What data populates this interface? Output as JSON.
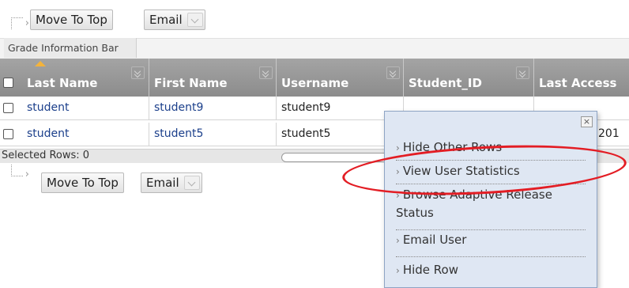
{
  "top_action_bar": {
    "move_to_top_label": "Move To Top",
    "email_label": "Email"
  },
  "info_bar": {
    "label": "Grade Information Bar"
  },
  "grid": {
    "columns": [
      {
        "label": "Last Name"
      },
      {
        "label": "First Name"
      },
      {
        "label": "Username"
      },
      {
        "label": "Student_ID"
      },
      {
        "label": "Last Access"
      }
    ],
    "rows": [
      {
        "last_name": "student",
        "first_name": "student9",
        "username": "student9",
        "student_id": "",
        "last_access": ""
      },
      {
        "last_name": "student",
        "first_name": "student5",
        "username": "student5",
        "student_id": "",
        "last_access": "201"
      }
    ]
  },
  "selected_rows": {
    "label": "Selected Rows: 0"
  },
  "bottom_action_bar": {
    "move_to_top_label": "Move To Top",
    "email_label": "Email"
  },
  "context_menu": {
    "close_label": "×",
    "items": [
      {
        "label": "Hide Other Rows"
      },
      {
        "label": "View User Statistics"
      },
      {
        "label": "Browse Adaptive Release Status"
      },
      {
        "label": "Email User"
      },
      {
        "label": "Hide Row"
      }
    ]
  },
  "colors": {
    "header_bg": "#999999",
    "link_text": "#1b3f8b",
    "menu_bg": "#dfe7f3",
    "highlight": "#e31d24",
    "sort_indicator": "#f4b33b"
  }
}
